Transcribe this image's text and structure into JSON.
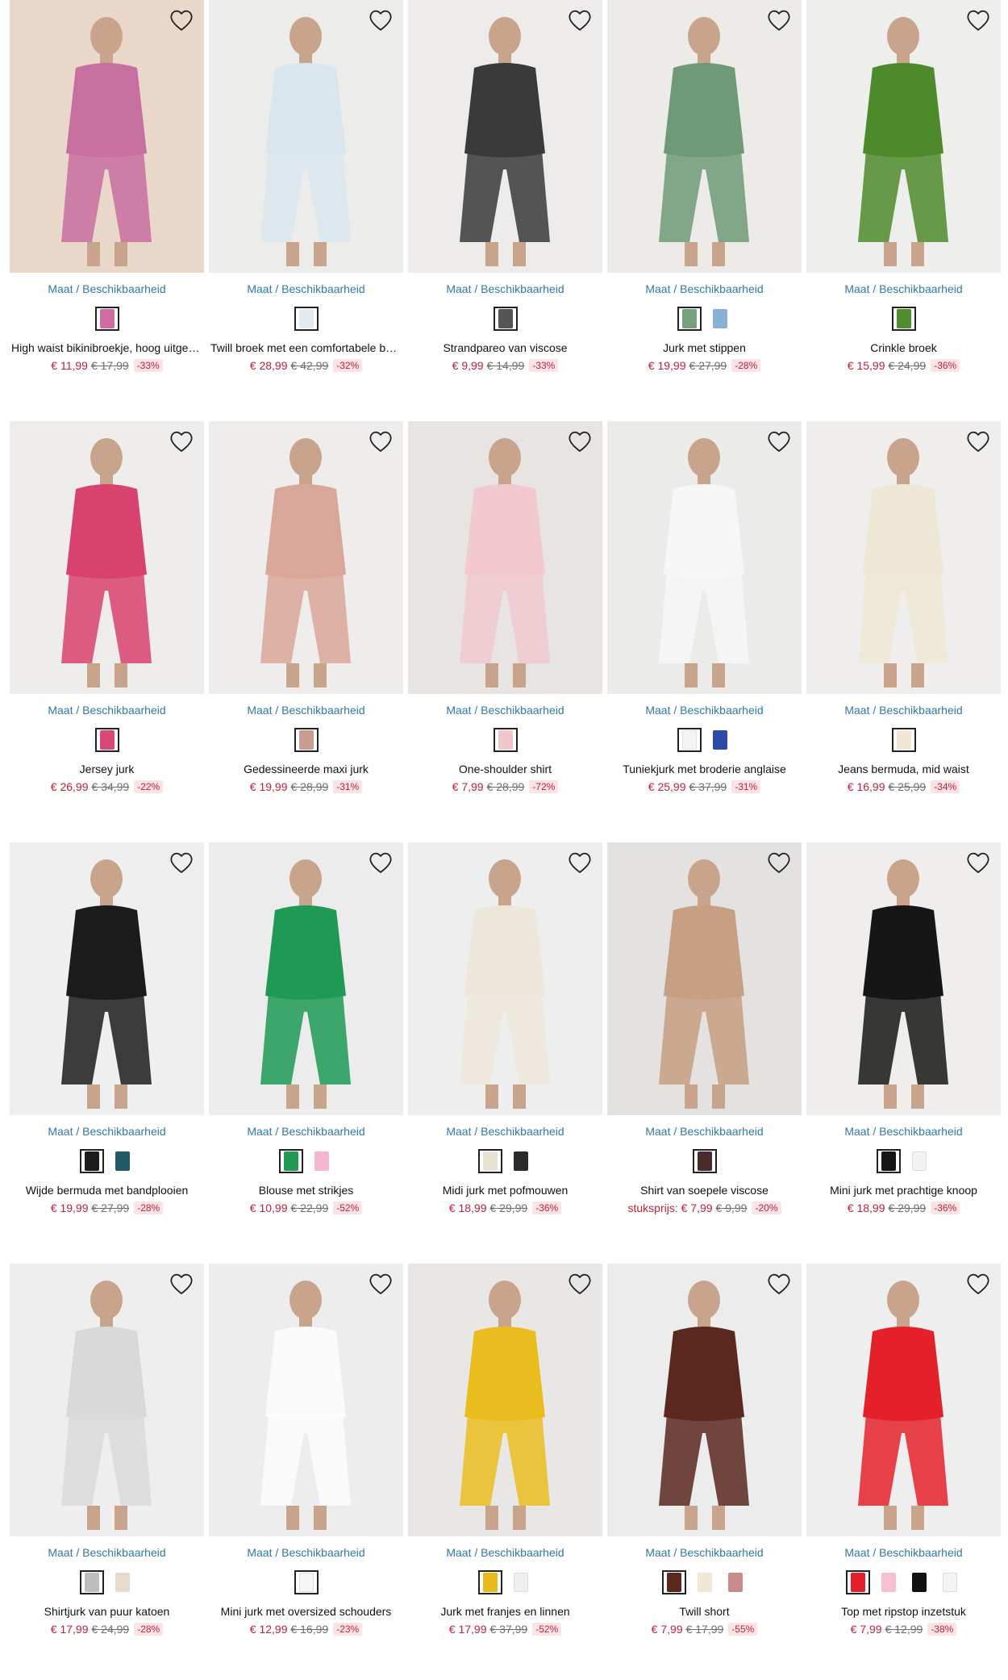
{
  "availability_label": "Maat / Beschikbaarheid",
  "colors": {
    "price": "#c0223a",
    "link": "#3178a8",
    "discount_bg": "#fbe3e6"
  },
  "products": [
    {
      "title": "High waist bikinibroekje, hoog uitgesneden",
      "price": "€ 11,99",
      "old_price": "€ 17,99",
      "discount": "-33%",
      "photo_bg": "#e9d7c9",
      "garment": "#c86fa1",
      "swatches": [
        "#d16ca3"
      ]
    },
    {
      "title": "Twill broek met een comfortabele band",
      "price": "€ 28,99",
      "old_price": "€ 42,99",
      "discount": "-32%",
      "photo_bg": "#ececea",
      "garment": "#d9e6ee",
      "swatches": [
        "#e2ebef"
      ]
    },
    {
      "title": "Strandpareo van viscose",
      "price": "€ 9,99",
      "old_price": "€ 14,99",
      "discount": "-33%",
      "photo_bg": "#eeeceb",
      "garment": "#3a3a3a",
      "swatches": [
        "#555555"
      ]
    },
    {
      "title": "Jurk met stippen",
      "price": "€ 19,99",
      "old_price": "€ 27,99",
      "discount": "-28%",
      "photo_bg": "#ecebe8",
      "garment": "#6f9a77",
      "swatches": [
        "#76a07c",
        "#8bb0d8"
      ]
    },
    {
      "title": "Crinkle broek",
      "price": "€ 15,99",
      "old_price": "€ 24,99",
      "discount": "-36%",
      "photo_bg": "#eeeeec",
      "garment": "#4d8a2c",
      "swatches": [
        "#4f8c2e"
      ]
    },
    {
      "title": "Jersey jurk",
      "price": "€ 26,99",
      "old_price": "€ 34,99",
      "discount": "-22%",
      "photo_bg": "#eeedec",
      "garment": "#d8426f",
      "swatches": [
        "#d84a74"
      ]
    },
    {
      "title": "Gedessineerde maxi jurk",
      "price": "€ 19,99",
      "old_price": "€ 28,99",
      "discount": "-31%",
      "photo_bg": "#eeedec",
      "garment": "#d9a69a",
      "swatches": [
        "#c99c8f"
      ]
    },
    {
      "title": "One-shoulder shirt",
      "price": "€ 7,99",
      "old_price": "€ 28,99",
      "discount": "-72%",
      "photo_bg": "#e7e4e1",
      "garment": "#f1c9cf",
      "swatches": [
        "#f0c6cc"
      ]
    },
    {
      "title": "Tuniekjurk met broderie anglaise",
      "price": "€ 25,99",
      "old_price": "€ 37,99",
      "discount": "-31%",
      "photo_bg": "#ebebea",
      "garment": "#f7f7f7",
      "swatches": [
        "#f4f4f4",
        "#2d4aa8"
      ]
    },
    {
      "title": "Jeans bermuda, mid waist",
      "price": "€ 16,99",
      "old_price": "€ 25,99",
      "discount": "-34%",
      "photo_bg": "#efeeec",
      "garment": "#efe7d6",
      "swatches": [
        "#efe6d4"
      ]
    },
    {
      "title": "Wijde bermuda met bandplooien",
      "price": "€ 19,99",
      "old_price": "€ 27,99",
      "discount": "-28%",
      "photo_bg": "#efefef",
      "garment": "#1b1b1b",
      "swatches": [
        "#1b1b1b",
        "#1f5b66"
      ]
    },
    {
      "title": "Blouse met strikjes",
      "price": "€ 10,99",
      "old_price": "€ 22,99",
      "discount": "-52%",
      "photo_bg": "#ececec",
      "garment": "#1f9a55",
      "swatches": [
        "#1f9a55",
        "#f3b5cf"
      ]
    },
    {
      "title": "Midi jurk met pofmouwen",
      "price": "€ 18,99",
      "old_price": "€ 29,99",
      "discount": "-36%",
      "photo_bg": "#eeeeee",
      "garment": "#ece7da",
      "swatches": [
        "#e8e2d3",
        "#2a2a2a"
      ]
    },
    {
      "title": "Shirt van soepele viscose",
      "unit_label": "stuksprijs:",
      "price": "€ 7,99",
      "old_price": "€ 9,99",
      "discount": "-20%",
      "photo_bg": "#e4e2e0",
      "garment": "#c79f82",
      "swatches": [
        "#4a2b2b"
      ]
    },
    {
      "title": "Mini jurk met prachtige knoop",
      "price": "€ 18,99",
      "old_price": "€ 29,99",
      "discount": "-36%",
      "photo_bg": "#efeeec",
      "garment": "#161616",
      "swatches": [
        "#161616",
        "#f2f2f2"
      ]
    },
    {
      "title": "Shirtjurk van puur katoen",
      "price": "€ 17,99",
      "old_price": "€ 24,99",
      "discount": "-28%",
      "photo_bg": "#eeeeee",
      "garment": "#d9d9d9",
      "swatches": [
        "#bdbdbd",
        "#e8d9cd"
      ]
    },
    {
      "title": "Mini jurk met oversized schouders",
      "price": "€ 12,99",
      "old_price": "€ 16,99",
      "discount": "-23%",
      "photo_bg": "#ededed",
      "garment": "#fbfbfb",
      "swatches": [
        "#f6f6f6"
      ]
    },
    {
      "title": "Jurk met franjes en linnen",
      "price": "€ 17,99",
      "old_price": "€ 37,99",
      "discount": "-52%",
      "photo_bg": "#e9e7e6",
      "garment": "#e9bd1d",
      "swatches": [
        "#e8ba1c",
        "#efefef"
      ]
    },
    {
      "title": "Twill short",
      "price": "€ 7,99",
      "old_price": "€ 17,99",
      "discount": "-55%",
      "photo_bg": "#ececec",
      "garment": "#5b2820",
      "swatches": [
        "#5b2820",
        "#efe6d4",
        "#c98a8a"
      ]
    },
    {
      "title": "Top met ripstop inzetstuk",
      "price": "€ 7,99",
      "old_price": "€ 12,99",
      "discount": "-38%",
      "photo_bg": "#eeeeee",
      "garment": "#e4212a",
      "swatches": [
        "#e4212a",
        "#f6bfd4",
        "#111111",
        "#f3f3f3"
      ]
    }
  ]
}
